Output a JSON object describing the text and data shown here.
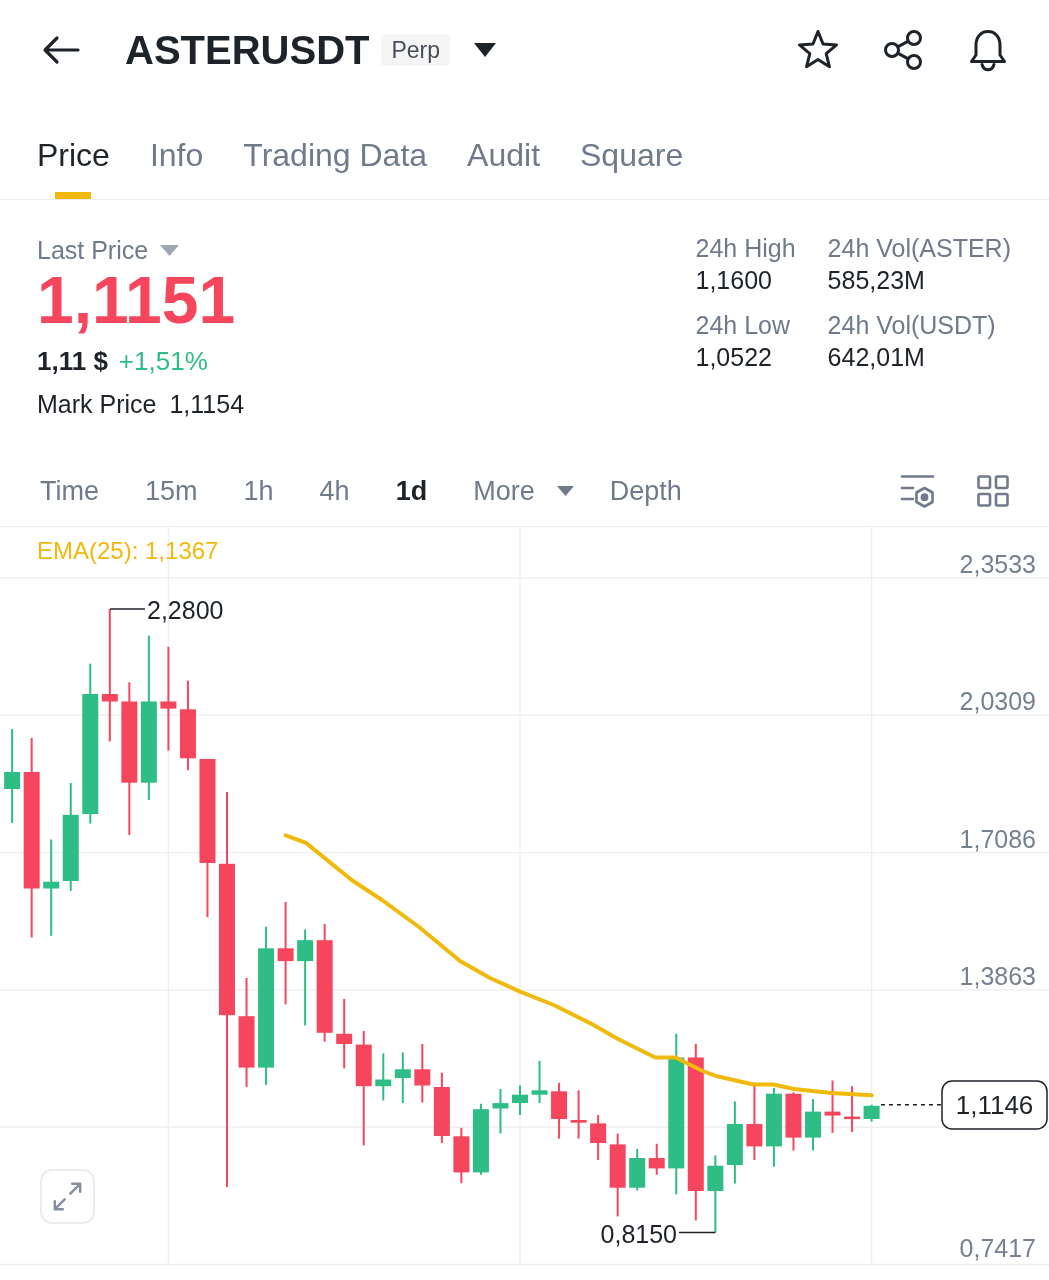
{
  "header": {
    "title": "ASTERUSDT",
    "badge": "Perp"
  },
  "tabs": [
    {
      "label": "Price",
      "selected": true
    },
    {
      "label": "Info",
      "selected": false
    },
    {
      "label": "Trading Data",
      "selected": false
    },
    {
      "label": "Audit",
      "selected": false
    },
    {
      "label": "Square",
      "selected": false
    }
  ],
  "ticker": {
    "last_price_label": "Last Price",
    "last_price": "1,1151",
    "last_price_rising": false,
    "usd_value": "1,11 $",
    "change": "+1,51%",
    "change_rising": true,
    "mark_price_label": "Mark Price",
    "mark_price": "1,1154"
  },
  "stats": [
    {
      "label": "24h High",
      "value": "1,1600"
    },
    {
      "label": "24h Vol(ASTER)",
      "value": "585,23M"
    },
    {
      "label": "24h Low",
      "value": "1,0522"
    },
    {
      "label": "24h Vol(USDT)",
      "value": "642,01M"
    }
  ],
  "intervals": [
    {
      "label": "Time",
      "kind": "interval",
      "selected": false
    },
    {
      "label": "15m",
      "kind": "interval",
      "selected": false
    },
    {
      "label": "1h",
      "kind": "interval",
      "selected": false
    },
    {
      "label": "4h",
      "kind": "interval",
      "selected": false
    },
    {
      "label": "1d",
      "kind": "interval",
      "selected": true
    },
    {
      "label": "More",
      "kind": "dropdown",
      "selected": false
    },
    {
      "label": "Depth",
      "kind": "tab",
      "selected": false
    }
  ],
  "chart": {
    "indicator": "EMA(25): 1,1367",
    "y_axis_labels": [
      "2,3533",
      "2,0309",
      "1,7086",
      "1,3863",
      "0,7417"
    ],
    "high_label": "2,2800",
    "low_label": "0,8150",
    "current_price": "1,1146"
  }
}
